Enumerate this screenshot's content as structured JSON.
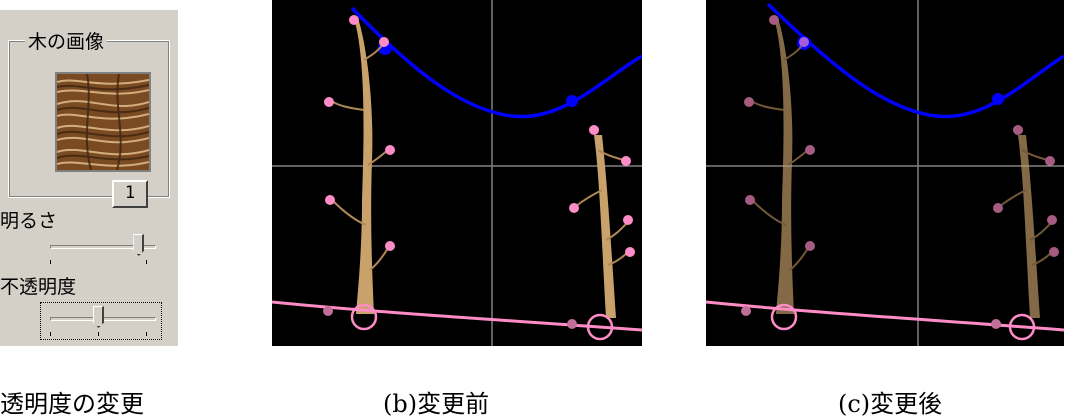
{
  "panel": {
    "group_title": "木の画像",
    "texture_button": "1",
    "brightness_label": "明るさ",
    "brightness_value": 0.92,
    "opacity_label": "不透明度",
    "opacity_value": 0.5
  },
  "captions": {
    "a": "透明度の変更",
    "b": "(b)変更前",
    "c": "(c)変更後"
  },
  "views": {
    "b": {
      "tree_opacity": 1.0
    },
    "c": {
      "tree_opacity": 0.65
    }
  },
  "colors": {
    "panel_bg": "#d4d0c8",
    "view_bg": "#000000",
    "curve_blue": "#0000ff",
    "ground_pink": "#ff8cc6",
    "blossom_pink": "#ff8cc6",
    "grid": "#808080",
    "trunk": "#c9a16b"
  }
}
